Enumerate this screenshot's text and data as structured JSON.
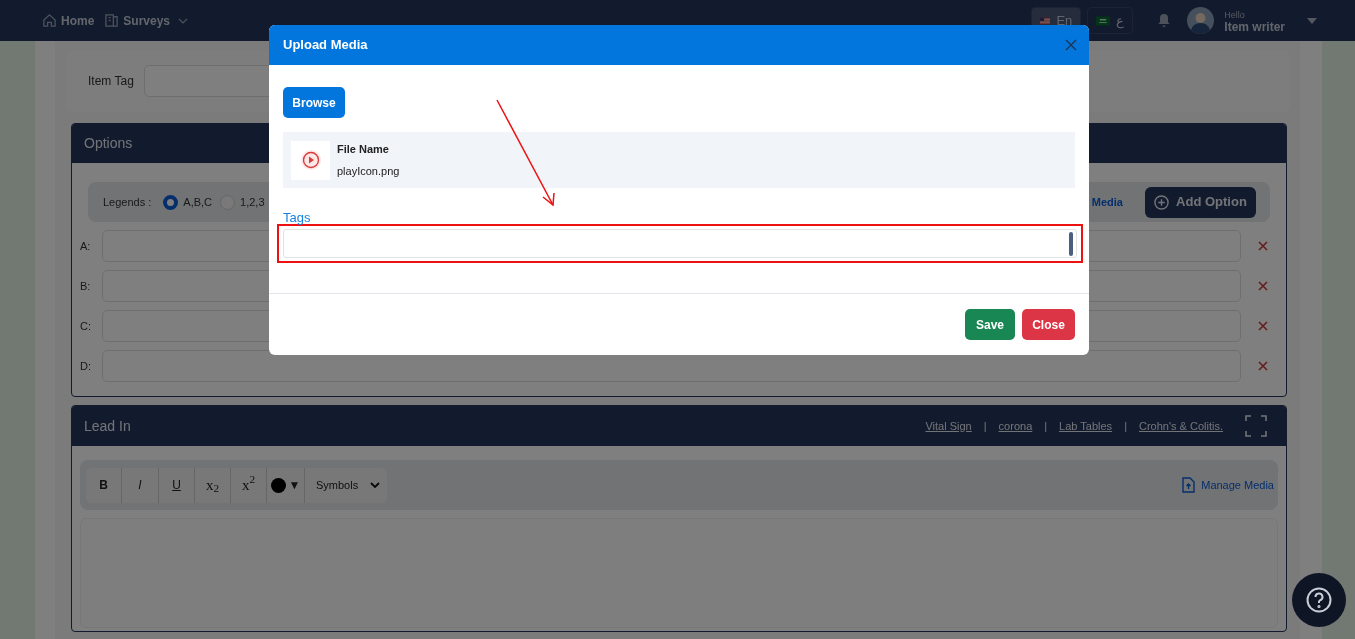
{
  "nav": {
    "links": [
      {
        "label": "Home",
        "kind": "home",
        "menu": false
      },
      {
        "label": "Surveys",
        "kind": "book",
        "menu": true
      }
    ],
    "languages": [
      {
        "label": "En",
        "kind": "us",
        "selected": true
      },
      {
        "label": "ع",
        "kind": "sa",
        "selected": false
      }
    ],
    "user": {
      "greeting": "Hello",
      "name": "Item writer"
    }
  },
  "item_tag": {
    "label": "Item Tag"
  },
  "options": {
    "title": "Options",
    "legends": {
      "label": "Legends :",
      "choices": [
        {
          "label": "A,B,C",
          "selected": true
        },
        {
          "label": "1,2,3",
          "selected": false
        }
      ]
    },
    "media_link": "Media",
    "add_button": "Add Option",
    "rows": [
      {
        "label": "A:"
      },
      {
        "label": "B:"
      },
      {
        "label": "C:"
      },
      {
        "label": "D:"
      }
    ]
  },
  "lead_in": {
    "title": "Lead In",
    "header_items": [
      {
        "kind": "link",
        "text": "Vital Sign"
      },
      {
        "kind": "separator",
        "text": "|"
      },
      {
        "kind": "link",
        "text": "corona"
      },
      {
        "kind": "separator",
        "text": "|"
      },
      {
        "kind": "link",
        "text": "Lab Tables"
      },
      {
        "kind": "separator",
        "text": "|"
      },
      {
        "kind": "link",
        "text": "Crohn's & Colitis."
      }
    ],
    "toolbar": [
      {
        "kind": "bold",
        "label": "B"
      },
      {
        "kind": "italic",
        "label": "I"
      },
      {
        "kind": "underline",
        "label": "U"
      },
      {
        "kind": "script",
        "label": "x$_{2}$"
      },
      {
        "kind": "script",
        "label": "x$^{2}$"
      },
      {
        "kind": "color",
        "label": "▼"
      },
      {
        "kind": "select",
        "label": "Symbols"
      }
    ],
    "manage_media": "Manage Media"
  },
  "modal": {
    "title": "Upload Media",
    "browse": "Browse",
    "file": {
      "heading": "File Name",
      "name": "playIcon.png"
    },
    "tags": {
      "label": "Tags"
    },
    "buttons": [
      {
        "kind": "save",
        "label": "Save"
      },
      {
        "kind": "close",
        "label": "Close"
      }
    ]
  }
}
